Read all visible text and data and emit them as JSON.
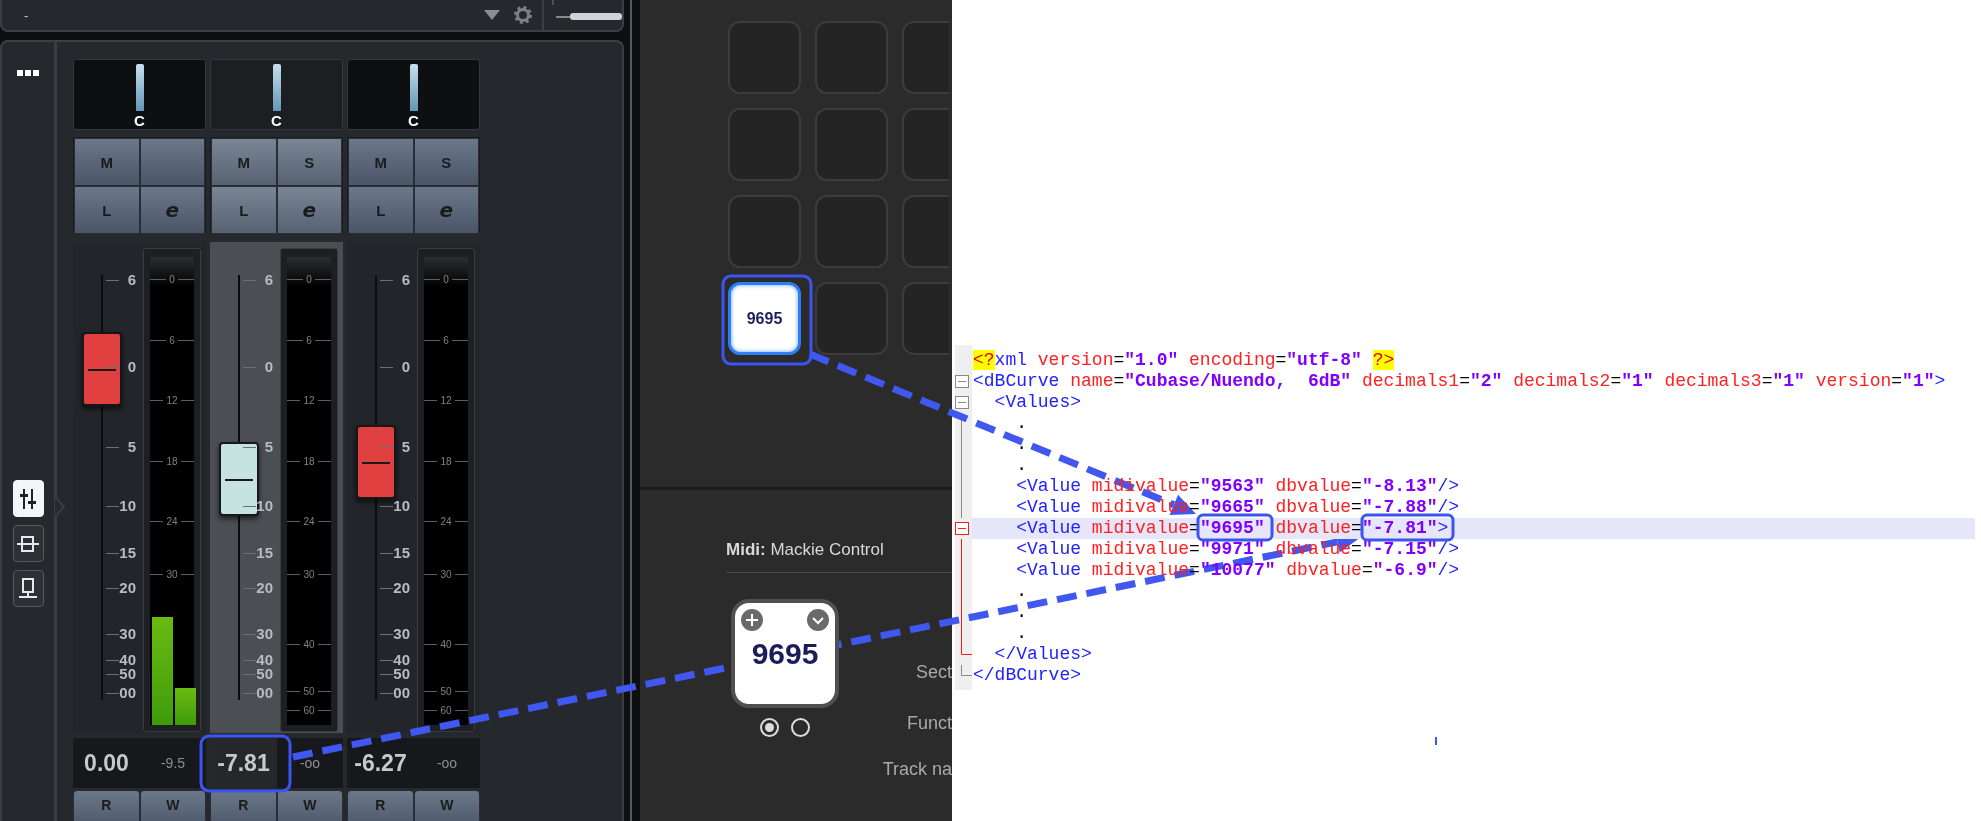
{
  "top_bar": {
    "label": "-"
  },
  "tools": [
    {
      "selected": true
    },
    {
      "selected": false
    },
    {
      "selected": false
    }
  ],
  "channels": [
    {
      "selected": false,
      "pan": "C",
      "buttons": [
        {
          "kind": "text",
          "label": "M"
        },
        {
          "kind": "blank"
        },
        {
          "kind": "text",
          "label": "L"
        },
        {
          "kind": "edit",
          "label": "e"
        }
      ],
      "fader_scale": [
        "6",
        "0",
        "5",
        "10",
        "15",
        "20",
        "30",
        "40",
        "50",
        "00"
      ],
      "meter_scale": [
        "0",
        "6",
        "12",
        "18",
        "24",
        "30"
      ],
      "fader": {
        "level": 0.78,
        "color": "#e0403f"
      },
      "meters": [
        {
          "level": 0.23
        },
        {
          "level": 0.08
        }
      ],
      "volume": "0.00",
      "peak": "-9.5",
      "automation": [
        "R",
        "W"
      ]
    },
    {
      "selected": true,
      "pan": "C",
      "buttons": [
        {
          "kind": "text",
          "label": "M"
        },
        {
          "kind": "text",
          "label": "S"
        },
        {
          "kind": "text",
          "label": "L"
        },
        {
          "kind": "edit",
          "label": "e"
        }
      ],
      "fader_scale": [
        "6",
        "0",
        "5",
        "10",
        "15",
        "20",
        "30",
        "40",
        "50",
        "00"
      ],
      "meter_scale": [
        "0",
        "6",
        "12",
        "18",
        "24",
        "30",
        "40",
        "50",
        "60"
      ],
      "fader": {
        "level": 0.52,
        "color": "#c6e3e0"
      },
      "meters": [
        {
          "level": 0
        },
        {
          "level": 0
        }
      ],
      "volume": "-7.81",
      "peak": "-oo",
      "automation": [
        "R",
        "W"
      ]
    },
    {
      "selected": false,
      "pan": "C",
      "buttons": [
        {
          "kind": "text",
          "label": "M"
        },
        {
          "kind": "text",
          "label": "S"
        },
        {
          "kind": "text",
          "label": "L"
        },
        {
          "kind": "edit",
          "label": "e"
        }
      ],
      "fader_scale": [
        "6",
        "0",
        "5",
        "10",
        "15",
        "20",
        "30",
        "40",
        "50",
        "00"
      ],
      "meter_scale": [
        "0",
        "6",
        "12",
        "18",
        "24",
        "30",
        "40",
        "50",
        "60"
      ],
      "fader": {
        "level": 0.56,
        "color": "#e0403f"
      },
      "meters": [
        {
          "level": 0
        },
        {
          "level": 0
        }
      ],
      "volume": "-6.27",
      "peak": "-oo",
      "automation": [
        "R",
        "W"
      ]
    }
  ],
  "pads": [
    {
      "selected": false
    },
    {
      "selected": false
    },
    {
      "selected": false
    },
    {
      "selected": false
    },
    {
      "selected": false
    },
    {
      "selected": false
    },
    {
      "selected": false
    },
    {
      "selected": false
    },
    {
      "selected": false
    },
    {
      "selected": true,
      "label": "9695"
    },
    {
      "selected": false
    },
    {
      "selected": false
    }
  ],
  "panel": {
    "midi": "**Midi:** Mackie Control",
    "card": {
      "label": "9695"
    },
    "pages": [
      {
        "selected": true
      },
      {
        "selected": false
      }
    ],
    "fields": [
      "Sect",
      "Funct",
      "Track na"
    ]
  },
  "editor": {
    "lines": [
      {
        "highlighted": false,
        "collapsible": false,
        "block_end": false,
        "tokens": [
          {
            "kind": "pi",
            "text": "<?"
          },
          {
            "kind": "tag",
            "text": "xml"
          },
          {
            "kind": "attr",
            "text": " version"
          },
          {
            "kind": "eq",
            "text": "="
          },
          {
            "kind": "value",
            "text": "\"1.0\""
          },
          {
            "kind": "attr",
            "text": " encoding"
          },
          {
            "kind": "eq",
            "text": "="
          },
          {
            "kind": "value",
            "text": "\"utf-8\" "
          },
          {
            "kind": "pi",
            "text": "?>"
          }
        ]
      },
      {
        "highlighted": false,
        "collapsible": true,
        "block_end": false,
        "tokens": [
          {
            "kind": "tag",
            "text": "<dBCurve"
          },
          {
            "kind": "attr",
            "text": " name"
          },
          {
            "kind": "eq",
            "text": "="
          },
          {
            "kind": "value",
            "text": "\"Cubase/Nuendo,  6dB\""
          },
          {
            "kind": "attr",
            "text": " decimals1"
          },
          {
            "kind": "eq",
            "text": "="
          },
          {
            "kind": "value",
            "text": "\"2\""
          },
          {
            "kind": "attr",
            "text": " decimals2"
          },
          {
            "kind": "eq",
            "text": "="
          },
          {
            "kind": "value",
            "text": "\"1\""
          },
          {
            "kind": "attr",
            "text": " decimals3"
          },
          {
            "kind": "eq",
            "text": "="
          },
          {
            "kind": "value",
            "text": "\"1\""
          },
          {
            "kind": "attr",
            "text": " version"
          },
          {
            "kind": "eq",
            "text": "="
          },
          {
            "kind": "value",
            "text": "\"1\""
          },
          {
            "kind": "tag",
            "text": ">"
          }
        ]
      },
      {
        "highlighted": false,
        "collapsible": true,
        "block_end": false,
        "tokens": [
          {
            "kind": "tag",
            "text": "  <Values>"
          }
        ]
      },
      {
        "highlighted": false,
        "collapsible": false,
        "block_end": false,
        "tokens": [
          {
            "kind": "text",
            "text": "    ."
          }
        ]
      },
      {
        "highlighted": false,
        "collapsible": false,
        "block_end": false,
        "tokens": [
          {
            "kind": "text",
            "text": "    ."
          }
        ]
      },
      {
        "highlighted": false,
        "collapsible": false,
        "block_end": false,
        "tokens": [
          {
            "kind": "text",
            "text": "    ."
          }
        ]
      },
      {
        "highlighted": false,
        "collapsible": false,
        "block_end": false,
        "tokens": [
          {
            "kind": "tag",
            "text": "    <Value"
          },
          {
            "kind": "attr",
            "text": " midivalue"
          },
          {
            "kind": "eq",
            "text": "="
          },
          {
            "kind": "value",
            "text": "\"9563\""
          },
          {
            "kind": "attr",
            "text": " dbvalue"
          },
          {
            "kind": "eq",
            "text": "="
          },
          {
            "kind": "value",
            "text": "\"-8.13\""
          },
          {
            "kind": "tag",
            "text": "/>"
          }
        ]
      },
      {
        "highlighted": false,
        "collapsible": false,
        "block_end": false,
        "tokens": [
          {
            "kind": "tag",
            "text": "    <Value"
          },
          {
            "kind": "attr",
            "text": " midivalue"
          },
          {
            "kind": "eq",
            "text": "="
          },
          {
            "kind": "value",
            "text": "\"9665\""
          },
          {
            "kind": "attr",
            "text": " dbvalue"
          },
          {
            "kind": "eq",
            "text": "="
          },
          {
            "kind": "value",
            "text": "\"-7.88\""
          },
          {
            "kind": "tag",
            "text": "/>"
          }
        ]
      },
      {
        "highlighted": true,
        "collapsible": true,
        "block_end": false,
        "tokens": [
          {
            "kind": "tag",
            "text": "    <Value"
          },
          {
            "kind": "attr",
            "text": " midivalue"
          },
          {
            "kind": "eq",
            "text": "="
          },
          {
            "kind": "value",
            "text": "\"9695\""
          },
          {
            "kind": "attr",
            "text": " dbvalue"
          },
          {
            "kind": "eq",
            "text": "="
          },
          {
            "kind": "value",
            "text": "\"-7.81\""
          },
          {
            "kind": "tag",
            "text": ">"
          }
        ]
      },
      {
        "highlighted": false,
        "collapsible": false,
        "block_end": false,
        "tokens": [
          {
            "kind": "tag",
            "text": "    <Value"
          },
          {
            "kind": "attr",
            "text": " midivalue"
          },
          {
            "kind": "eq",
            "text": "="
          },
          {
            "kind": "value",
            "text": "\"9971\""
          },
          {
            "kind": "attr",
            "text": " dbvalue"
          },
          {
            "kind": "eq",
            "text": "="
          },
          {
            "kind": "value",
            "text": "\"-7.15\""
          },
          {
            "kind": "tag",
            "text": "/>"
          }
        ]
      },
      {
        "highlighted": false,
        "collapsible": false,
        "block_end": false,
        "tokens": [
          {
            "kind": "tag",
            "text": "    <Value"
          },
          {
            "kind": "attr",
            "text": " midivalue"
          },
          {
            "kind": "eq",
            "text": "="
          },
          {
            "kind": "value",
            "text": "\"10077\""
          },
          {
            "kind": "attr",
            "text": " dbvalue"
          },
          {
            "kind": "eq",
            "text": "="
          },
          {
            "kind": "value",
            "text": "\"-6.9\""
          },
          {
            "kind": "tag",
            "text": "/>"
          }
        ]
      },
      {
        "highlighted": false,
        "collapsible": false,
        "block_end": false,
        "tokens": [
          {
            "kind": "text",
            "text": "    ."
          }
        ]
      },
      {
        "highlighted": false,
        "collapsible": false,
        "block_end": false,
        "tokens": [
          {
            "kind": "text",
            "text": "    ."
          }
        ]
      },
      {
        "highlighted": false,
        "collapsible": false,
        "block_end": false,
        "tokens": [
          {
            "kind": "text",
            "text": "    ."
          }
        ]
      },
      {
        "highlighted": false,
        "collapsible": false,
        "block_end": true,
        "tokens": [
          {
            "kind": "tag",
            "text": "  </Values>"
          }
        ]
      },
      {
        "highlighted": false,
        "collapsible": false,
        "block_end": true,
        "tokens": [
          {
            "kind": "tag",
            "text": "</dBCurve>"
          }
        ]
      }
    ]
  }
}
